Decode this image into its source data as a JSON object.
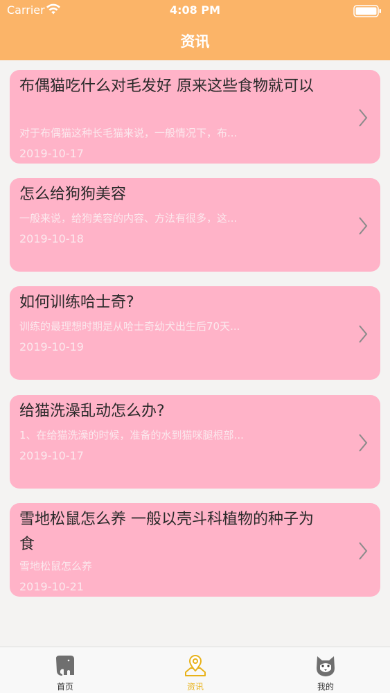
{
  "status_bar": {
    "carrier": "Carrier",
    "time": "4:08 PM"
  },
  "nav": {
    "title": "资讯"
  },
  "articles": [
    {
      "title": "布偶猫吃什么对毛发好 原来这些食物就可以",
      "desc": "对于布偶猫这种长毛猫来说，一般情况下，布...",
      "date": "2019-10-17"
    },
    {
      "title": "怎么给狗狗美容",
      "desc": "一般来说，给狗美容的内容、方法有很多，这...",
      "date": "2019-10-18"
    },
    {
      "title": "如何训练哈士奇?",
      "desc": "训练的最理想时期是从哈士奇幼犬出生后70天...",
      "date": "2019-10-19"
    },
    {
      "title": "给猫洗澡乱动怎么办?",
      "desc": "1、在给猫洗澡的时候，准备的水到猫咪腿根部...",
      "date": "2019-10-17"
    },
    {
      "title": "雪地松鼠怎么养 一般以壳斗科植物的种子为食",
      "desc": "雪地松鼠怎么养",
      "date": "2019-10-21"
    }
  ],
  "tabbar": {
    "tabs": [
      {
        "label": "首页",
        "icon": "elephant-icon",
        "active": false
      },
      {
        "label": "资讯",
        "icon": "location-pin-icon",
        "active": true
      },
      {
        "label": "我的",
        "icon": "husky-icon",
        "active": false
      }
    ]
  },
  "colors": {
    "header": "#fbb468",
    "card": "#ffb3c8",
    "active_tab": "#e8b21a"
  }
}
